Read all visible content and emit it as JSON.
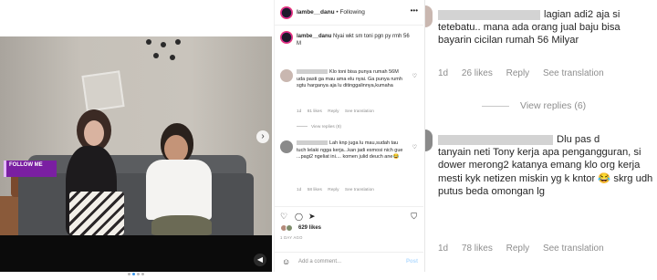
{
  "colors": {
    "link_blue": "#3897f0",
    "muted_text": "#8e8e8e",
    "primary_text": "#262626",
    "badge_purple": "#7a1fa2"
  },
  "video": {
    "follow_badge": {
      "title": "FOLLOW ME",
      "subtitle": ""
    },
    "carousel": {
      "count": 4,
      "active": 2
    },
    "next_icon": "chevron-right-icon",
    "sound_icon": "speaker-icon"
  },
  "post": {
    "username": "lambe__danu",
    "separator": "•",
    "follow_label": "Following",
    "more_icon": "ellipsis-icon",
    "caption": {
      "username": "lambe__danu",
      "text": "Nyai wkt sm toni pgn py rmh 56 M"
    },
    "comments": [
      {
        "text": "Klo toni bisa punya rumah 56M uda pasti ga mau ama elu nyai. Ga punya rumh sgtu harganya aja lu ditinggalinnya,kumaha",
        "time": "1d",
        "likes": "81 likes",
        "reply": "Reply",
        "translate": "See translation",
        "view_replies": "View replies (8)"
      },
      {
        "text": "Lah knp juga lu mau,sudah tau tuch lelaki ngga kerja...kan jadi esmosi nich gue ...pagi2 ngeliat ini.... komen julid deuch ane😂",
        "time": "1d",
        "likes": "58 likes",
        "reply": "Reply",
        "translate": "See translation"
      }
    ],
    "actions": {
      "like_icon": "heart-icon",
      "comment_icon": "comment-icon",
      "share_icon": "paper-plane-icon",
      "save_icon": "bookmark-icon"
    },
    "likes_count": "629 likes",
    "date": "1 DAY AGO",
    "add_comment": {
      "emoji_icon": "smiley-icon",
      "placeholder": "Add a comment...",
      "post_label": "Post"
    }
  },
  "zoom": {
    "comment_one": {
      "line1": "lagian adi2 aja si",
      "rest": "tetebatu.. mana ada orang jual baju bisa bayarin cicilan rumah 56 Milyar",
      "time": "1d",
      "likes": "26 likes",
      "reply": "Reply",
      "translate": "See translation",
      "view_replies": "View replies (6)"
    },
    "comment_two": {
      "line1": "Dlu pas d",
      "rest": "tanyain neti Tony kerja apa pengangguran, si dower merong2 katanya emang klo org kerja mesti kyk netizen miskin yg k kntor 😂 skrg udh putus beda omongan lg",
      "time": "1d",
      "likes": "78 likes",
      "reply": "Reply",
      "translate": "See translation"
    }
  }
}
